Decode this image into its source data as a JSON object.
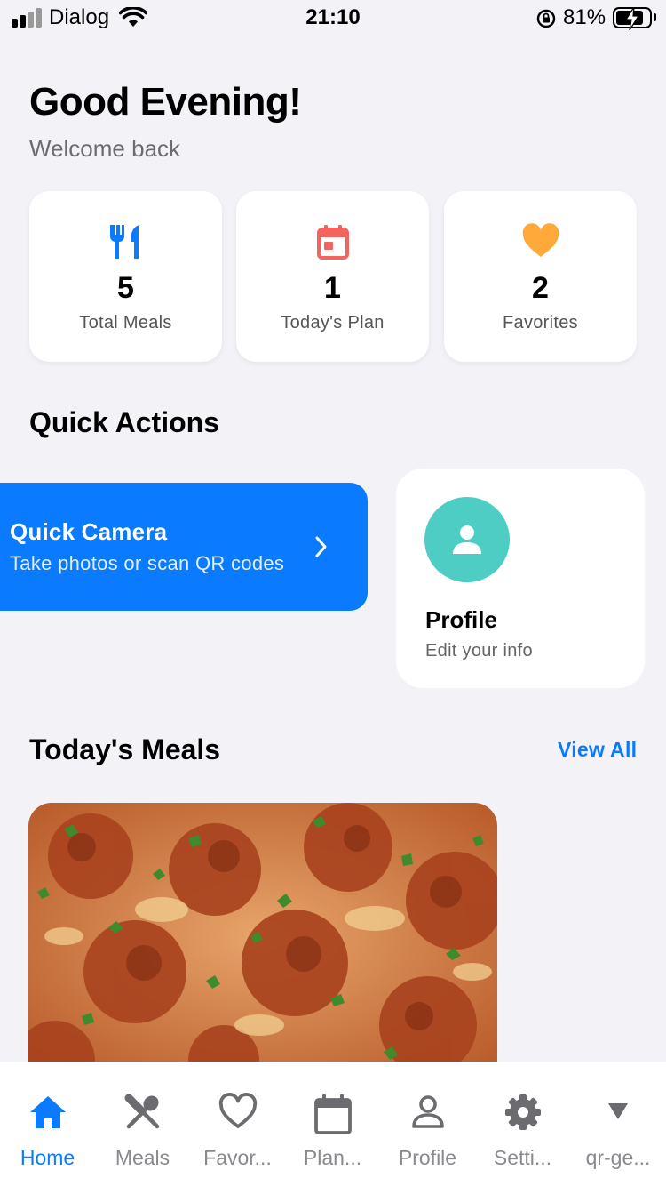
{
  "status_bar": {
    "carrier": "Dialog",
    "time": "21:10",
    "battery_percent": "81%",
    "battery_level": 0.81
  },
  "header": {
    "greeting": "Good Evening!",
    "subtitle": "Welcome back"
  },
  "stats": [
    {
      "icon": "fork-knife-icon",
      "value": "5",
      "label": "Total Meals",
      "color": "#0a7aff"
    },
    {
      "icon": "calendar-icon",
      "value": "1",
      "label": "Today's Plan",
      "color": "#f4645f"
    },
    {
      "icon": "heart-icon",
      "value": "2",
      "label": "Favorites",
      "color": "#ffa93a"
    }
  ],
  "quick_actions": {
    "title": "Quick Actions",
    "camera": {
      "title": "Quick Camera",
      "subtitle": "Take photos or scan QR codes",
      "color": "#0a7aff"
    },
    "profile": {
      "title": "Profile",
      "subtitle": "Edit your info",
      "avatar_color": "#4ecdc4"
    }
  },
  "todays_meals": {
    "title": "Today's Meals",
    "view_all": "View All"
  },
  "tabs": [
    {
      "label": "Home",
      "icon": "home-icon",
      "active": true
    },
    {
      "label": "Meals",
      "icon": "utensils-icon",
      "active": false
    },
    {
      "label": "Favor...",
      "icon": "heart-outline-icon",
      "active": false
    },
    {
      "label": "Plan...",
      "icon": "calendar-icon",
      "active": false
    },
    {
      "label": "Profile",
      "icon": "person-icon",
      "active": false
    },
    {
      "label": "Setti...",
      "icon": "gear-icon",
      "active": false
    },
    {
      "label": "qr-ge...",
      "icon": "triangle-down-icon",
      "active": false
    }
  ],
  "colors": {
    "accent": "#0a7aff",
    "background": "#f2f2f7",
    "inactive_tab": "#8a8a8e"
  }
}
